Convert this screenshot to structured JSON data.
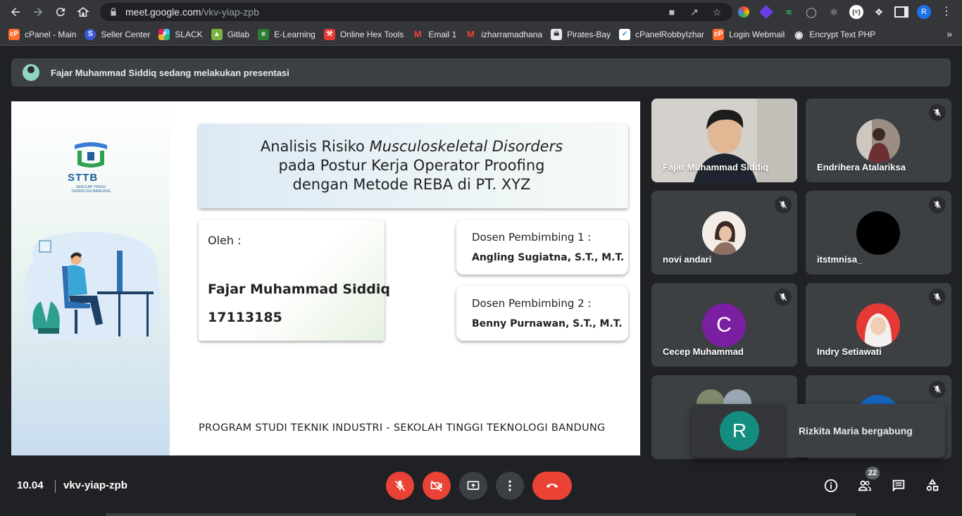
{
  "browser": {
    "url_host": "meet.google.com",
    "url_path": "/vkv-yiap-zpb",
    "profile_initial": "R",
    "bookmarks": [
      {
        "label": "cPanel - Main",
        "icon": "cpanel-icon",
        "color": "#ff6c2c"
      },
      {
        "label": "Seller Center",
        "icon": "seller-icon",
        "color": "#3b5bdb"
      },
      {
        "label": "SLACK",
        "icon": "slack-icon",
        "color": "#e01e5a"
      },
      {
        "label": "Gitlab",
        "icon": "gitlab-icon",
        "color": "#2e7d32"
      },
      {
        "label": "E-Learning",
        "icon": "elearning-icon",
        "color": "#43a047"
      },
      {
        "label": "Online Hex Tools",
        "icon": "hex-icon",
        "color": "#e53935"
      },
      {
        "label": "Email 1",
        "icon": "gmail-icon",
        "color": "#ea4335"
      },
      {
        "label": "izharramadhana",
        "icon": "gmail-icon",
        "color": "#ea4335"
      },
      {
        "label": "Pirates-Bay",
        "icon": "pirate-icon",
        "color": "#5f6368"
      },
      {
        "label": "cPanelRobbyIzhar",
        "icon": "robby-icon",
        "color": "#1e88e5"
      },
      {
        "label": "Login Webmail",
        "icon": "cpanel-icon",
        "color": "#ff6c2c"
      },
      {
        "label": "Encrypt Text PHP",
        "icon": "encrypt-icon",
        "color": "#bdc1c6"
      }
    ]
  },
  "meet": {
    "presenting_banner": "Fajar Muhammad Siddiq sedang melakukan presentasi",
    "slide": {
      "logo_text": "STTB",
      "logo_sub": "SEKOLAH TINGGI TEKNOLOGI BANDUNG",
      "title_line1_a": "Analisis Risiko ",
      "title_line1_b": "Musculoskeletal Disorders",
      "title_line2": "pada Postur Kerja Operator Proofing",
      "title_line3": "dengan Metode REBA di PT. XYZ",
      "by_label": "Oleh :",
      "author_name": "Fajar Muhammad Siddiq",
      "author_nim": "17113185",
      "advisor1_label": "Dosen Pembimbing 1 :",
      "advisor1_name": "Angling Sugiatna, S.T., M.T.",
      "advisor2_label": "Dosen Pembimbing 2 :",
      "advisor2_name": "Benny Purnawan, S.T., M.T.",
      "footer": "PROGRAM STUDI TEKNIK INDUSTRI  -  SEKOLAH TINGGI TEKNOLOGI BANDUNG"
    },
    "participants": [
      {
        "name": "Fajar Muhammad Siddiq",
        "video": true,
        "muted": false
      },
      {
        "name": "Endrihera Atalariksa",
        "muted": true,
        "avatar_color": "#7a6a6a"
      },
      {
        "name": "novi andari",
        "muted": true,
        "avatar_color": "#e8dcd6"
      },
      {
        "name": "itstmnisa_",
        "muted": true,
        "avatar_color": "#000000"
      },
      {
        "name": "Cecep Muhammad",
        "muted": true,
        "avatar_letter": "C",
        "avatar_color": "#7b1fa2"
      },
      {
        "name": "Indry Setiawati",
        "muted": true,
        "avatar_color": "#e53935"
      }
    ],
    "toast": {
      "initial": "R",
      "text": "Rizkita Maria bergabung",
      "color": "#148c80"
    },
    "bottom": {
      "time": "10.04",
      "meeting_code": "vkv-yiap-zpb",
      "participant_count": "22"
    }
  }
}
